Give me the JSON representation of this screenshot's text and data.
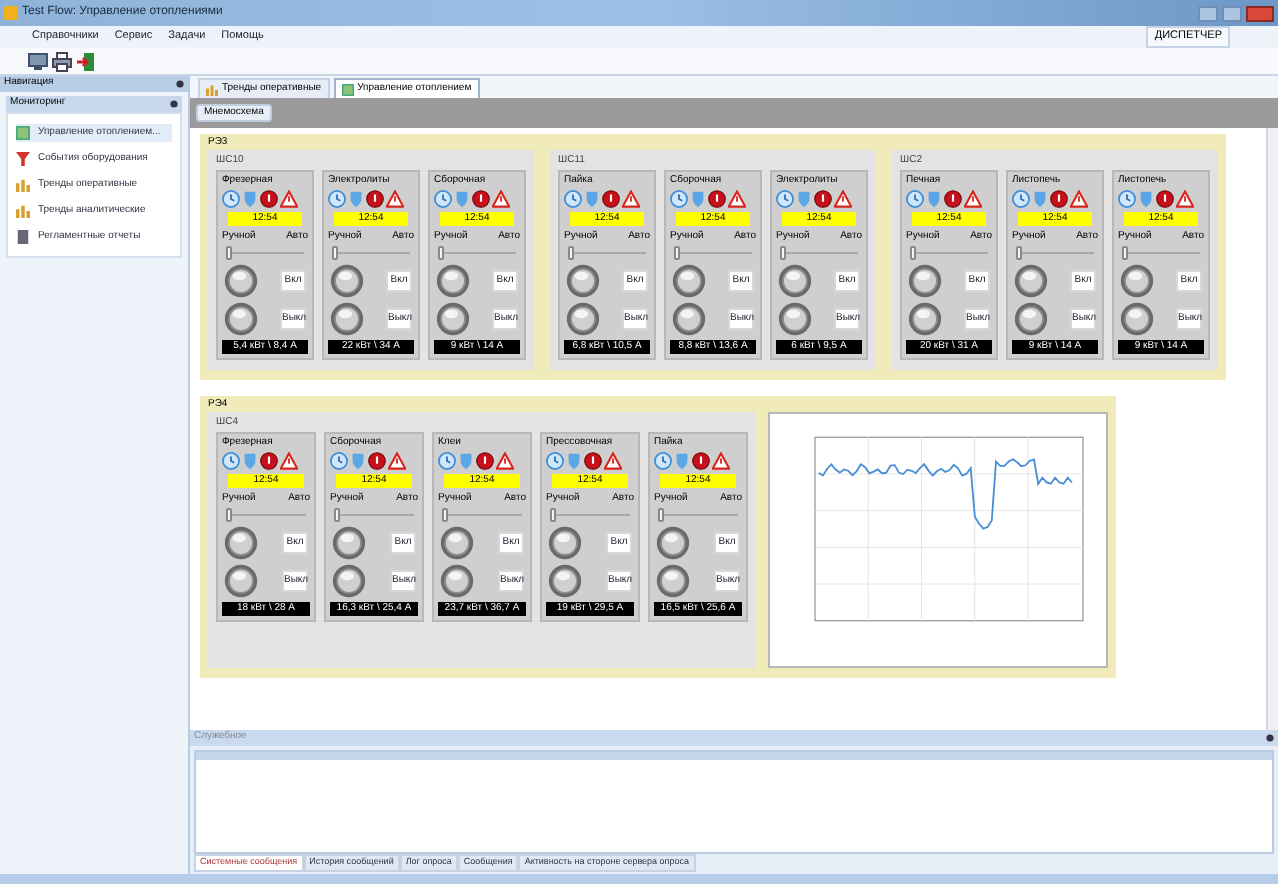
{
  "window": {
    "title": "Test Flow: Управление отоплениями"
  },
  "menu": [
    "Справочники",
    "Сервис",
    "Задачи",
    "Помощь"
  ],
  "user": "ДИСПЕТЧЕР",
  "sidebar": {
    "title": "Навигация",
    "section": "Мониторинг",
    "items": [
      {
        "label": "Управление отоплением...",
        "selected": true
      },
      {
        "label": "События оборудования",
        "selected": false
      },
      {
        "label": "Тренды оперативные",
        "selected": false
      },
      {
        "label": "Тренды аналитические",
        "selected": false
      },
      {
        "label": "Регламентные отчеты",
        "selected": false
      }
    ]
  },
  "tabs": [
    {
      "label": "Тренды оперативные",
      "selected": false
    },
    {
      "label": "Управление отоплением",
      "selected": true
    }
  ],
  "subtab": {
    "label": "Мнемосхема",
    "selected": true
  },
  "groups": [
    {
      "name": "РЭ3",
      "subgroups": [
        {
          "name": "ШС10",
          "units": [
            {
              "name": "Фрезерная",
              "time": "12:54",
              "manual": "Ручной",
              "auto": "Авто",
              "level": 0,
              "on": "Вкл",
              "off": "Выкл",
              "reading": "5,4 кВт \\ 8,4 А"
            },
            {
              "name": "Электролиты",
              "time": "12:54",
              "manual": "Ручной",
              "auto": "Авто",
              "level": 0,
              "on": "Вкл",
              "off": "Выкл",
              "reading": "22 кВт \\ 34 А"
            },
            {
              "name": "Сборочная",
              "time": "12:54",
              "manual": "Ручной",
              "auto": "Авто",
              "level": 0,
              "on": "Вкл",
              "off": "Выкл",
              "reading": "9 кВт \\ 14 А"
            }
          ]
        },
        {
          "name": "ШС11",
          "units": [
            {
              "name": "Пайка",
              "time": "12:54",
              "manual": "Ручной",
              "auto": "Авто",
              "level": 0,
              "on": "Вкл",
              "off": "Выкл",
              "reading": "6,8 кВт \\ 10,5 А"
            },
            {
              "name": "Сборочная",
              "time": "12:54",
              "manual": "Ручной",
              "auto": "Авто",
              "level": 0,
              "on": "Вкл",
              "off": "Выкл",
              "reading": "8,8 кВт \\ 13,6 А"
            },
            {
              "name": "Электролиты",
              "time": "12:54",
              "manual": "Ручной",
              "auto": "Авто",
              "level": 0,
              "on": "Вкл",
              "off": "Выкл",
              "reading": "6 кВт \\ 9,5 А"
            }
          ]
        },
        {
          "name": "ШС2",
          "units": [
            {
              "name": "Печная",
              "time": "12:54",
              "manual": "Ручной",
              "auto": "Авто",
              "level": 0,
              "on": "Вкл",
              "off": "Выкл",
              "reading": "20 кВт \\ 31 А"
            },
            {
              "name": "Листопечь",
              "time": "12:54",
              "manual": "Ручной",
              "auto": "Авто",
              "level": 0,
              "on": "Вкл",
              "off": "Выкл",
              "reading": "9 кВт \\ 14 А"
            },
            {
              "name": "Листопечь",
              "time": "12:54",
              "manual": "Ручной",
              "auto": "Авто",
              "level": 0,
              "on": "Вкл",
              "off": "Выкл",
              "reading": "9 кВт \\ 14 А"
            }
          ]
        }
      ]
    },
    {
      "name": "РЭ4",
      "subgroups": [
        {
          "name": "ШС4",
          "units": [
            {
              "name": "Фрезерная",
              "time": "12:54",
              "manual": "Ручной",
              "auto": "Авто",
              "level": 0,
              "on": "Вкл",
              "off": "Выкл",
              "reading": "18 кВт \\ 28 А"
            },
            {
              "name": "Сборочная",
              "time": "12:54",
              "manual": "Ручной",
              "auto": "Авто",
              "level": 0,
              "on": "Вкл",
              "off": "Выкл",
              "reading": "16,3 кВт \\ 25,4 А"
            },
            {
              "name": "Клеи",
              "time": "12:54",
              "manual": "Ручной",
              "auto": "Авто",
              "level": 0,
              "on": "Вкл",
              "off": "Выкл",
              "reading": "23,7 кВт \\ 36,7 А"
            },
            {
              "name": "Прессовочная",
              "time": "12:54",
              "manual": "Ручной",
              "auto": "Авто",
              "level": 0,
              "on": "Вкл",
              "off": "Выкл",
              "reading": "19 кВт \\ 29,5 А"
            },
            {
              "name": "Пайка",
              "time": "12:54",
              "manual": "Ручной",
              "auto": "Авто",
              "level": 0,
              "on": "Вкл",
              "off": "Выкл",
              "reading": "16,5 кВт \\ 25,6 А"
            }
          ]
        }
      ]
    }
  ],
  "messages": {
    "title": "Служебное",
    "tabs": [
      {
        "label": "Системные сообщения",
        "selected": true
      },
      {
        "label": "История сообщений",
        "selected": false
      },
      {
        "label": "Лог опроса",
        "selected": false
      },
      {
        "label": "Сообщения",
        "selected": false
      },
      {
        "label": "Активность на стороне сервера опроса",
        "selected": false
      }
    ]
  }
}
